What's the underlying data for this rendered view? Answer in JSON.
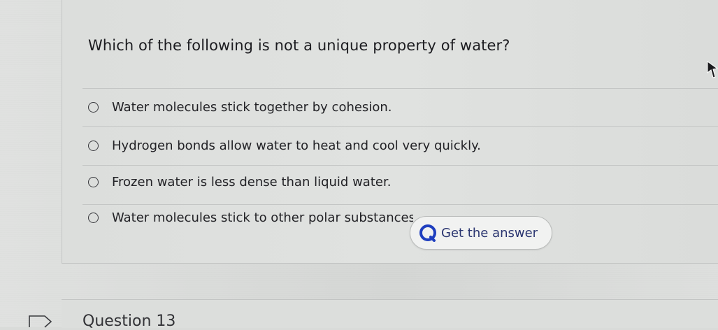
{
  "question": {
    "text": "Which of the following is not a unique property of water?",
    "options": [
      {
        "label": "Water molecules stick together by cohesion."
      },
      {
        "label": "Hydrogen bonds allow water to heat and cool very quickly."
      },
      {
        "label": "Frozen water is less dense than liquid water."
      },
      {
        "label": "Water molecules stick to other polar substances."
      }
    ]
  },
  "answer_button": {
    "label": "Get the answer",
    "icon": "search-bubble-icon"
  },
  "next_question": {
    "title": "Question 13",
    "icon": "bookmark-flag-icon"
  },
  "colors": {
    "background": "#d9dbd9",
    "text": "#1f1f22",
    "button_text": "#2a3570",
    "button_icon": "#1f3fbf"
  }
}
